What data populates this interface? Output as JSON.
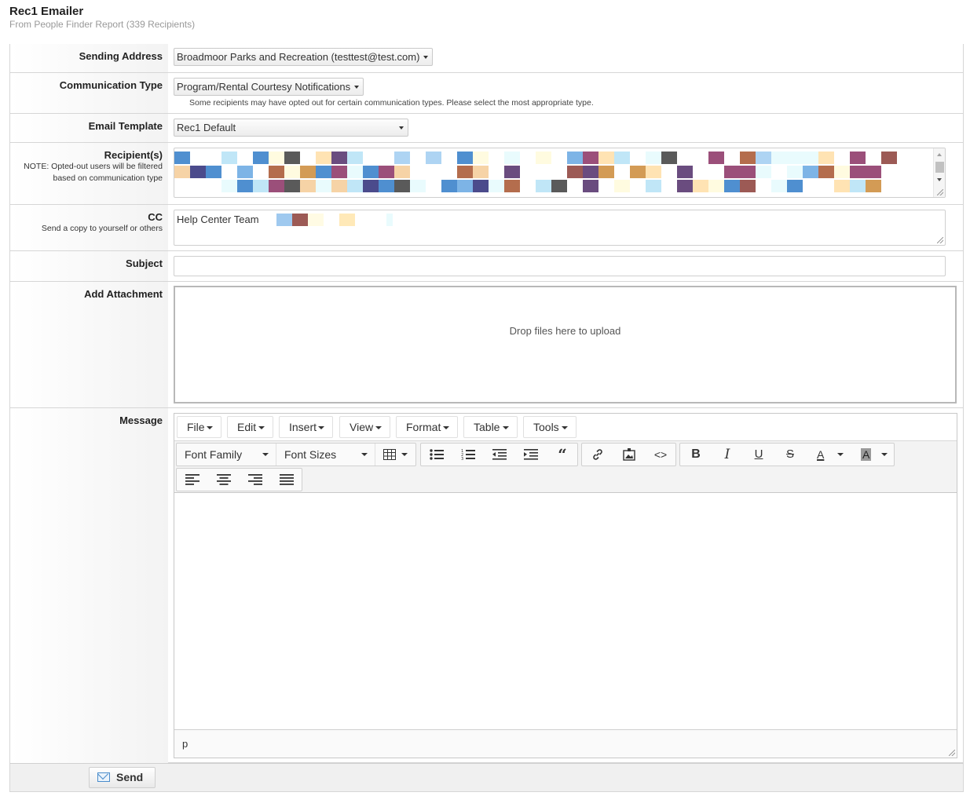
{
  "header": {
    "title": "Rec1 Emailer",
    "subtitle": "From People Finder Report (339 Recipients)"
  },
  "sending_address": {
    "label": "Sending Address",
    "value": "Broadmoor Parks and Recreation (testtest@test.com)"
  },
  "communication_type": {
    "label": "Communication Type",
    "value": "Program/Rental Courtesy Notifications",
    "hint": "Some recipients may have opted out for certain communication types. Please select the most appropriate type."
  },
  "email_template": {
    "label": "Email Template",
    "value": "Rec1 Default"
  },
  "recipients": {
    "label": "Recipient(s)",
    "note_line1": "NOTE: Opted-out users will be filtered",
    "note_line2": "based on communication type"
  },
  "cc": {
    "label": "CC",
    "note": "Send a copy to yourself or others",
    "value": "Help Center Team"
  },
  "subject": {
    "label": "Subject",
    "value": ""
  },
  "attachment": {
    "label": "Add Attachment",
    "dropzone_text": "Drop files here to upload"
  },
  "message": {
    "label": "Message",
    "menu": [
      "File",
      "Edit",
      "Insert",
      "View",
      "Format",
      "Table",
      "Tools"
    ],
    "font_family": "Font Family",
    "font_sizes": "Font Sizes",
    "status_path": "p"
  },
  "footer": {
    "send_label": "Send"
  },
  "colors": {
    "border": "#d6d6d6",
    "label_bg": "#f3f3f3",
    "send_icon": "#4a8ccb"
  }
}
